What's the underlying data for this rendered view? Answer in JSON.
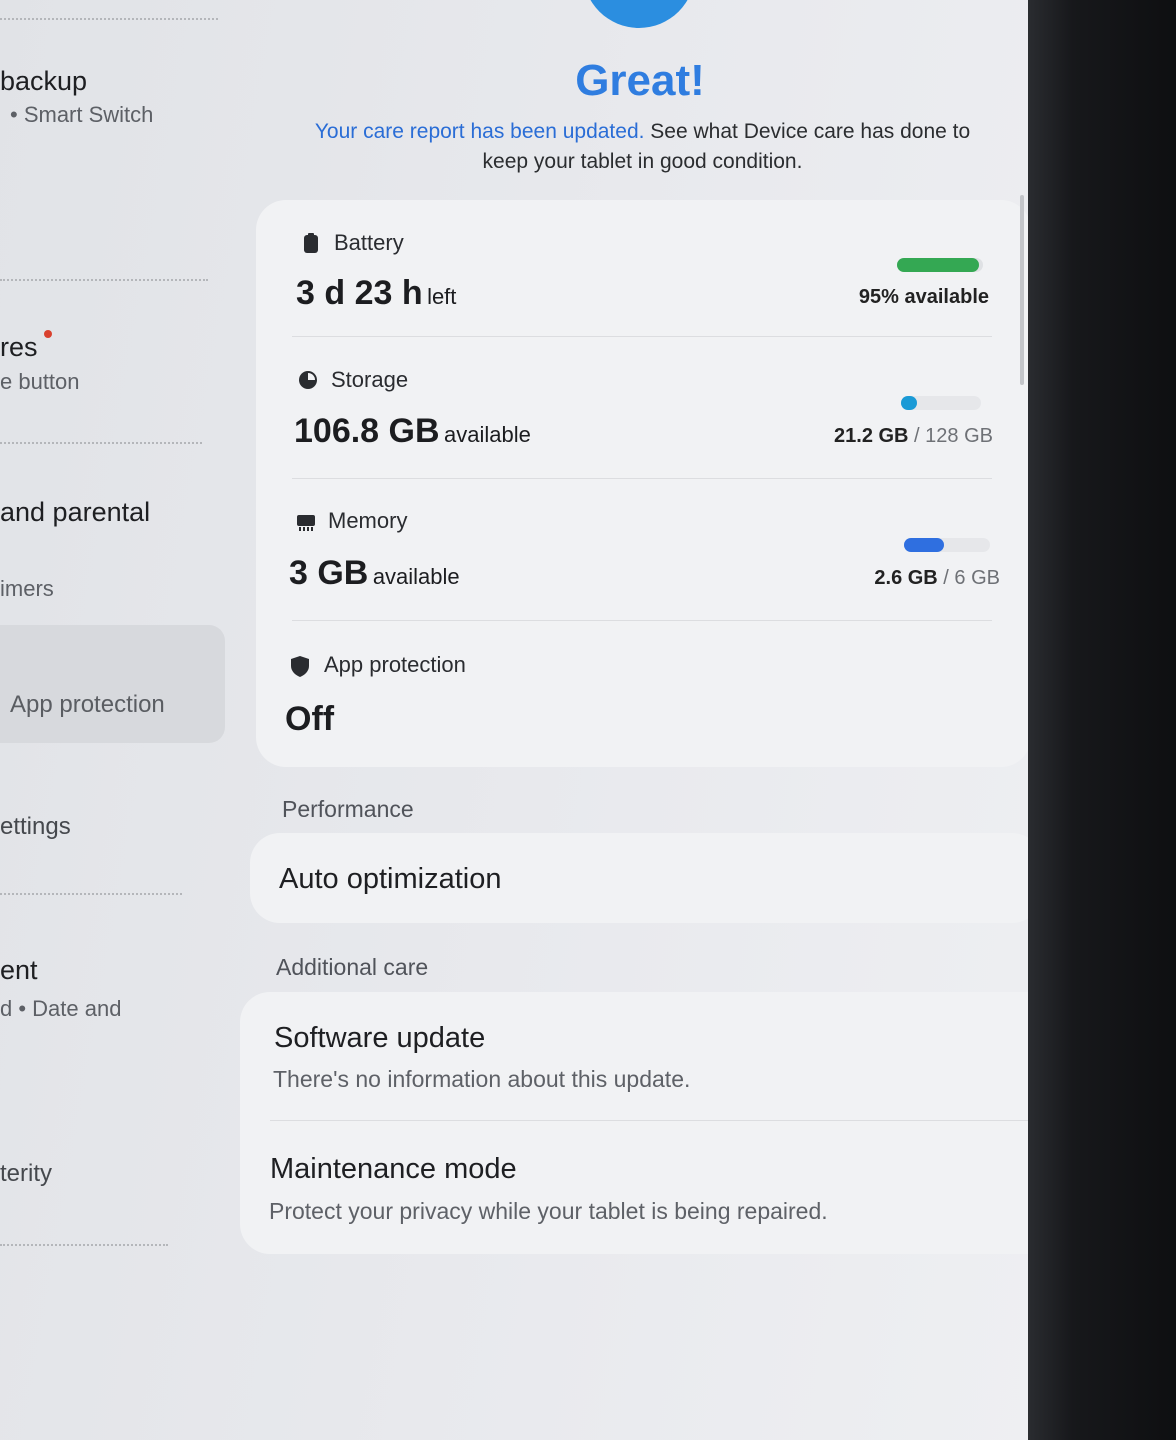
{
  "left_panel": {
    "items": [
      {
        "title": "backup",
        "subtitle": "• Smart Switch"
      },
      {
        "title": "res",
        "subtitle": "e button"
      },
      {
        "title": "and parental",
        "subtitle": "imers"
      },
      {
        "title": "App protection"
      },
      {
        "title": "ettings"
      },
      {
        "title": "ent",
        "subtitle": "d  •  Date and"
      },
      {
        "title": "terity"
      }
    ]
  },
  "header": {
    "title": "Great!",
    "message_link": "Your care report has been updated.",
    "message_rest": " See what Device care has done to keep your tablet in good condition."
  },
  "status": {
    "battery": {
      "label": "Battery",
      "value": "3 d 23 h",
      "unit": "left",
      "right_text": "95% available",
      "level": 0.95,
      "color": "#34a853"
    },
    "storage": {
      "label": "Storage",
      "value": "106.8 GB",
      "unit": "available",
      "used": "21.2 GB",
      "sep": " / ",
      "total": "128 GB",
      "color": "#1a9ad6"
    },
    "memory": {
      "label": "Memory",
      "value": "3 GB",
      "unit": "available",
      "used": "2.6 GB",
      "sep": " / ",
      "total": "6 GB",
      "color": "#2f6fe0"
    },
    "app_protection": {
      "label": "App protection",
      "value": "Off"
    }
  },
  "performance": {
    "heading": "Performance",
    "items": [
      {
        "title": "Auto optimization"
      }
    ]
  },
  "additional_care": {
    "heading": "Additional care",
    "items": [
      {
        "title": "Software update",
        "subtitle": "There's no information about this update."
      },
      {
        "title": "Maintenance mode",
        "subtitle": "Protect your privacy while your tablet is being repaired."
      }
    ]
  }
}
